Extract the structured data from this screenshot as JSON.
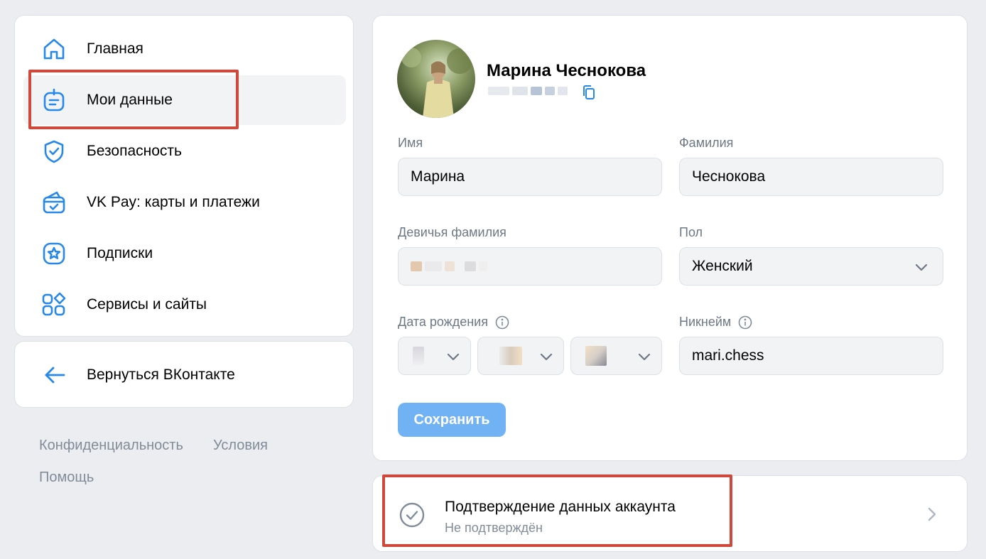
{
  "nav": {
    "items": [
      {
        "label": "Главная",
        "icon": "home-icon"
      },
      {
        "label": "Мои данные",
        "icon": "personal-data-icon",
        "active": true
      },
      {
        "label": "Безопасность",
        "icon": "shield-icon"
      },
      {
        "label": "VK Pay: карты и платежи",
        "icon": "wallet-icon"
      },
      {
        "label": "Подписки",
        "icon": "star-icon"
      },
      {
        "label": "Сервисы и сайты",
        "icon": "services-icon"
      }
    ],
    "back_label": "Вернуться ВКонтакте"
  },
  "footer": {
    "privacy": "Конфиденциальность",
    "terms": "Условия",
    "help": "Помощь"
  },
  "profile": {
    "name": "Марина Чеснокова",
    "first_name_label": "Имя",
    "first_name": "Марина",
    "last_name_label": "Фамилия",
    "last_name": "Чеснокова",
    "maiden_label": "Девичья фамилия",
    "gender_label": "Пол",
    "gender": "Женский",
    "birthdate_label": "Дата рождения",
    "nickname_label": "Никнейм",
    "nickname": "mari.chess",
    "save_label": "Сохранить"
  },
  "verification": {
    "title": "Подтверждение данных аккаунта",
    "status": "Не подтверждён"
  },
  "colors": {
    "accent": "#2688eb",
    "highlight": "#d0473c",
    "save_button": "#70b2f3"
  }
}
